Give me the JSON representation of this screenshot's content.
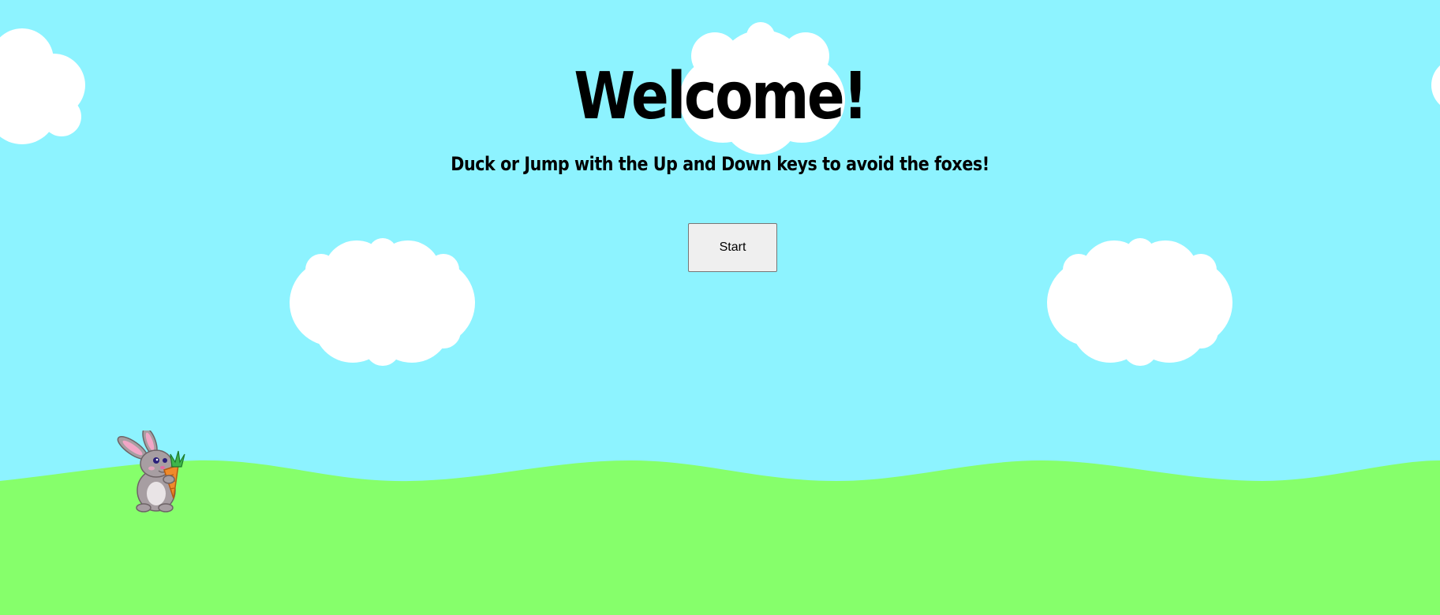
{
  "game": {
    "title": "Welcome!",
    "instructions": "Duck or Jump with the Up and Down keys to avoid the foxes!",
    "start_label": "Start"
  },
  "colors": {
    "sky": "#8df3ff",
    "grass": "#86ff6b",
    "cloud": "#ffffff"
  },
  "sprites": {
    "player": "bunny-holding-carrot",
    "scenery": [
      "cloud",
      "cloud",
      "cloud",
      "cloud",
      "cloud"
    ]
  }
}
